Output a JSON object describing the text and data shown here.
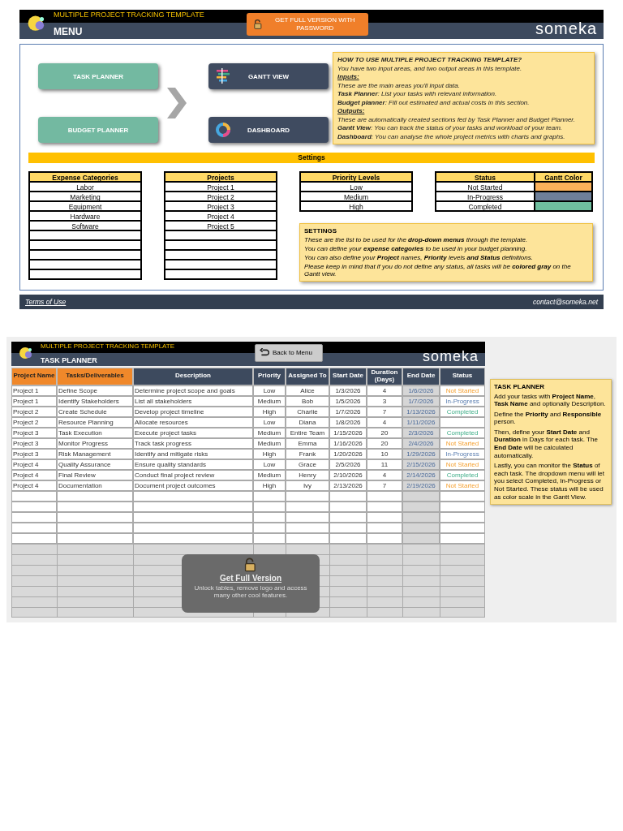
{
  "menu_sheet": {
    "header": {
      "title": "MULTIPLE PROJECT TRACKING TEMPLATE",
      "subtitle": "MENU",
      "unlock_button": "GET FULL VERSION WITH PASSWORD",
      "logo": "someka"
    },
    "nav_buttons": [
      {
        "label": "TASK PLANNER",
        "kind": "input"
      },
      {
        "label": "GANTT VIEW",
        "kind": "gantt"
      },
      {
        "label": "BUDGET PLANNER",
        "kind": "input"
      },
      {
        "label": "DASHBOARD",
        "kind": "dashboard"
      }
    ],
    "help_note": [
      {
        "kind": "heading",
        "text": "HOW TO USE MULTIPLE PROJECT TRACKING TEMPLATE?"
      },
      {
        "kind": "text",
        "text": "You have two input areas, and two output areas in this template."
      },
      {
        "kind": "section",
        "text": "Inputs:"
      },
      {
        "kind": "text",
        "text": "These are the main areas you'll input data."
      },
      {
        "kind": "text",
        "text": "**Task Planner**: List your tasks with relevant information."
      },
      {
        "kind": "text",
        "text": "**Budget planner**: Fill out estimated and actual costs in this section."
      },
      {
        "kind": "section",
        "text": "Outputs:"
      },
      {
        "kind": "text",
        "text": "These are automatically created sections fed by Task Planner and Budget Planner."
      },
      {
        "kind": "text",
        "text": "**Gantt View**: You can track the status of your tasks and workload of your team."
      },
      {
        "kind": "text",
        "text": "**Dashboard**: You can analyse the whole project metrics with charts and graphs."
      }
    ],
    "settings": {
      "title": "Settings",
      "lists": [
        {
          "heading": "Expense Categories",
          "items": [
            "Labor",
            "Marketing",
            "Equipment",
            "Hardware",
            "Software"
          ]
        },
        {
          "heading": "Projects",
          "items": [
            "Project 1",
            "Project 2",
            "Project 3",
            "Project 4",
            "Project 5"
          ]
        },
        {
          "heading": "Priority Levels",
          "items": [
            "Low",
            "Medium",
            "High"
          ]
        }
      ],
      "status_table": {
        "headings": [
          "Status",
          "Gantt Color"
        ],
        "items": [
          {
            "label": "Not Started",
            "color": "#fbb15a"
          },
          {
            "label": "In-Progress",
            "color": "#6e7f99"
          },
          {
            "label": "Completed",
            "color": "#6fbf9f"
          }
        ]
      },
      "note": [
        "SETTINGS",
        "These are the list to be used for the **drop-down menus** through the template.",
        "You can define your **expense categories** to be used in your budget planning.",
        "You can also define your **Project** names, **Priority** levels **and Status** definitions.",
        "Please keep in mind that if you do not define any status, all tasks will be **colored gray** on the Gantt view."
      ]
    },
    "footer": {
      "link": "Terms of Use",
      "contact": "contact@someka.net"
    }
  },
  "task_planner_sheet": {
    "header": {
      "title": "MULTIPLE PROJECT TRACKING TEMPLATE",
      "subtitle": "TASK PLANNER",
      "back_button": "Back to Menu",
      "logo": "someka"
    },
    "columns": [
      {
        "label": "Project Name",
        "kind": "key"
      },
      {
        "label": "Tasks/Deliverables",
        "kind": "key"
      },
      {
        "label": "Description",
        "kind": "plain"
      },
      {
        "label": "Priority",
        "kind": "plain"
      },
      {
        "label": "Assigned To",
        "kind": "plain"
      },
      {
        "label": "Start Date",
        "kind": "plain"
      },
      {
        "label": "Duration (Days)",
        "kind": "plain"
      },
      {
        "label": "End Date",
        "kind": "calculated"
      },
      {
        "label": "Status",
        "kind": "plain"
      }
    ],
    "rows": [
      {
        "cells": [
          "Project 1",
          "Define Scope",
          "Determine project scope and goals",
          "Low",
          "Alice",
          "1/3/2026",
          "4",
          "1/6/2026"
        ],
        "status": "Not Started",
        "kind": "not_started"
      },
      {
        "cells": [
          "Project 1",
          "Identify Stakeholders",
          "List all stakeholders",
          "Medium",
          "Bob",
          "1/5/2026",
          "3",
          "1/7/2026"
        ],
        "status": "In-Progress",
        "kind": "in_progress"
      },
      {
        "cells": [
          "Project 2",
          "Create Schedule",
          "Develop project timeline",
          "High",
          "Charlie",
          "1/7/2026",
          "7",
          "1/13/2026"
        ],
        "status": "Completed",
        "kind": "completed"
      },
      {
        "cells": [
          "Project 2",
          "Resource Planning",
          "Allocate resources",
          "Low",
          "Diana",
          "1/8/2026",
          "4",
          "1/11/2026"
        ],
        "kind": "none"
      },
      {
        "cells": [
          "Project 3",
          "Task Execution",
          "Execute project tasks",
          "Medium",
          "Entire Team",
          "1/15/2026",
          "20",
          "2/3/2026"
        ],
        "status": "Completed",
        "kind": "completed"
      },
      {
        "cells": [
          "Project 3",
          "Monitor Progress",
          "Track task progress",
          "Medium",
          "Emma",
          "1/16/2026",
          "20",
          "2/4/2026"
        ],
        "status": "Not Started",
        "kind": "not_started"
      },
      {
        "cells": [
          "Project 3",
          "Risk Management",
          "Identify and mitigate risks",
          "High",
          "Frank",
          "1/20/2026",
          "10",
          "1/29/2026"
        ],
        "status": "In-Progress",
        "kind": "in_progress"
      },
      {
        "cells": [
          "Project 4",
          "Quality Assurance",
          "Ensure quality standards",
          "Low",
          "Grace",
          "2/5/2026",
          "11",
          "2/15/2026"
        ],
        "status": "Not Started",
        "kind": "not_started"
      },
      {
        "cells": [
          "Project 4",
          "Final Review",
          "Conduct final project review",
          "Medium",
          "Henry",
          "2/10/2026",
          "4",
          "2/14/2026"
        ],
        "status": "Completed",
        "kind": "completed"
      },
      {
        "cells": [
          "Project 4",
          "Documentation",
          "Document project outcomes",
          "High",
          "Ivy",
          "2/13/2026",
          "7",
          "2/19/2026"
        ],
        "status": "Not Started",
        "kind": "not_started"
      }
    ],
    "note": {
      "title": "TASK PLANNER",
      "paragraphs": [
        "Add your tasks with **Project Name**, **Task Name** and optionally Description.",
        "Define the **Priority** and **Responsible** person.",
        "Then, define your **Start Date** and **Duration** in Days for each task. The **End Date** will be calculated automatically.",
        "Lastly, you can monitor the **Status** of each task. The dropdown menu will let you select Completed, In-Progress or Not Started. These status will be used as color scale in the Gantt View."
      ]
    },
    "overlay": {
      "title": "Get Full Version",
      "text": "Unlock tables, remove logo and access many other cool features."
    }
  }
}
